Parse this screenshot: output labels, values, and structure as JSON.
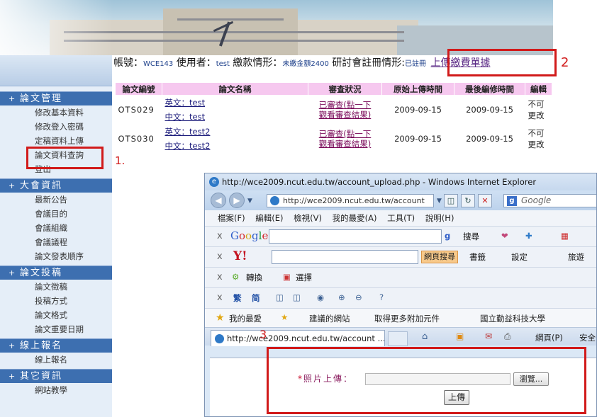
{
  "sidebar": {
    "sections": [
      {
        "title": "論文管理",
        "items": [
          "修改基本資料",
          "修改登入密碼",
          "定稿資料上傳",
          "論文資料查詢",
          "登出"
        ]
      },
      {
        "title": "大會資訊",
        "items": [
          "最新公告",
          "會議目的",
          "會議組織",
          "會議議程",
          "論文發表順序"
        ]
      },
      {
        "title": "論文投稿",
        "items": [
          "論文徵稿",
          "投稿方式",
          "論文格式",
          "論文重要日期"
        ]
      },
      {
        "title": "線上報名",
        "items": [
          "線上報名"
        ]
      },
      {
        "title": "其它資訊",
        "items": [
          "網站教學"
        ]
      }
    ]
  },
  "header": {
    "account_label": "帳號：",
    "account_value": "WCE143",
    "user_label": "使用者：",
    "user_value": "test",
    "payment_label": "繳款情形：",
    "payment_value": "未繳金額2400",
    "registration_label": "研討會註冊情形:",
    "registration_value": "已註冊",
    "upload_link": "上傳繳費單據"
  },
  "table": {
    "headers": [
      "論文編號",
      "論文名稱",
      "審查狀況",
      "原始上傳時間",
      "最後編修時間",
      "編輯"
    ],
    "rows": [
      {
        "id": "OTS029",
        "en_title": "英文：test",
        "zh_title": "中文：test",
        "review_1": "已審查(點一下",
        "review_2": "觀看審查結果)",
        "uploaded": "2009-09-15",
        "modified": "2009-09-15",
        "edit_1": "不可",
        "edit_2": "更改"
      },
      {
        "id": "OTS030",
        "en_title": "英文：test2",
        "zh_title": "中文：test2",
        "review_1": "已審查(點一下",
        "review_2": "觀看審查結果)",
        "uploaded": "2009-09-15",
        "modified": "2009-09-15",
        "edit_1": "不可",
        "edit_2": "更改"
      }
    ]
  },
  "annotations": {
    "n1": "1.",
    "n2": "2",
    "n3": "3",
    "color": "#d11a1a"
  },
  "browser": {
    "title": "http://wce2009.ncut.edu.tw/account_upload.php - Windows Internet Explorer",
    "address": "http://wce2009.ncut.edu.tw/account",
    "search_placeholder": "Google",
    "menu": [
      "檔案(F)",
      "編輯(E)",
      "檢視(V)",
      "我的最愛(A)",
      "工具(T)",
      "說明(H)"
    ],
    "google_search": "搜尋",
    "yahoo_search": "網頁搜尋",
    "yahoo_bookmarks": "書籤",
    "yahoo_settings": "設定",
    "yahoo_travel": "旅遊",
    "convert": "轉換",
    "select": "選擇",
    "trad": "繁",
    "simp": "简",
    "favorites": "我的最愛",
    "suggested_sites": "建議的網站",
    "addons": "取得更多附加元件",
    "ncut": "國立勤益科技大學",
    "tab_title": "http://wce2009.ncut.edu.tw/account ...",
    "page_menu": "網頁(P)",
    "safety_menu": "安全"
  },
  "upload_form": {
    "required_mark": "*",
    "label": "照片上傳：",
    "browse": "瀏覽...",
    "submit": "上傳"
  }
}
